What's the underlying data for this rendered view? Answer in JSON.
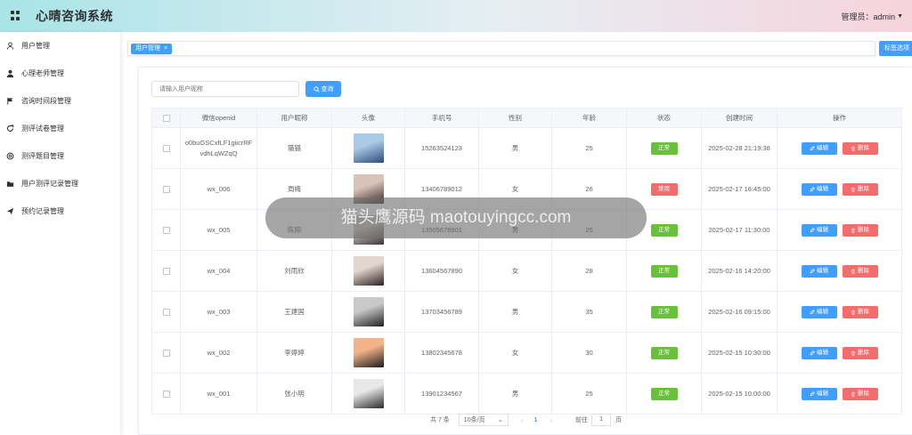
{
  "header": {
    "title": "心晴咨询系统",
    "user_label": "管理员：admin"
  },
  "sidebar": {
    "items": [
      {
        "label": "用户管理",
        "icon": "user-icon"
      },
      {
        "label": "心理老师管理",
        "icon": "user-filled-icon"
      },
      {
        "label": "咨询时间段管理",
        "icon": "flag-icon"
      },
      {
        "label": "测评试卷管理",
        "icon": "refresh-icon"
      },
      {
        "label": "测评题目管理",
        "icon": "circle-icon"
      },
      {
        "label": "用户测评记录管理",
        "icon": "folder-icon"
      },
      {
        "label": "预约记录管理",
        "icon": "send-icon"
      }
    ]
  },
  "tabs": {
    "active_tab": "用户管理",
    "options_label": "标签选项"
  },
  "search": {
    "placeholder": "请输入用户昵称",
    "button_label": "查询"
  },
  "table": {
    "columns": [
      "微信openid",
      "用户昵称",
      "头像",
      "手机号",
      "性别",
      "年龄",
      "状态",
      "创建时间",
      "操作"
    ],
    "edit_label": "编辑",
    "delete_label": "删除",
    "rows": [
      {
        "openid": "o0buGSCxfLF1giicrRFvdhLqWZqQ",
        "nickname": "猫猫",
        "phone": "15263524123",
        "gender": "男",
        "age": "25",
        "status": "正常",
        "created": "2025-02-28 21:19:38",
        "avatar": [
          "#a9cbe6",
          "#2c4b7a"
        ]
      },
      {
        "openid": "wx_006",
        "nickname": "周梅",
        "phone": "13406789012",
        "gender": "女",
        "age": "26",
        "status": "禁用",
        "created": "2025-02-17 16:45:00",
        "avatar": [
          "#d9c2b8",
          "#3a2a27"
        ]
      },
      {
        "openid": "wx_005",
        "nickname": "陈阳",
        "phone": "13505678901",
        "gender": "男",
        "age": "25",
        "status": "正常",
        "created": "2025-02-17 11:30:00",
        "avatar": [
          "#c7c4c1",
          "#3b3633"
        ]
      },
      {
        "openid": "wx_004",
        "nickname": "刘雨欣",
        "phone": "13604567890",
        "gender": "女",
        "age": "28",
        "status": "正常",
        "created": "2025-02-16 14:20:00",
        "avatar": [
          "#e3d6cf",
          "#2b211e"
        ]
      },
      {
        "openid": "wx_003",
        "nickname": "王建国",
        "phone": "13703456789",
        "gender": "男",
        "age": "35",
        "status": "正常",
        "created": "2025-02-16 09:15:00",
        "avatar": [
          "#c9c9c9",
          "#1f1f1f"
        ]
      },
      {
        "openid": "wx_002",
        "nickname": "李婷婷",
        "phone": "13802345678",
        "gender": "女",
        "age": "30",
        "status": "正常",
        "created": "2025-02-15 10:30:00",
        "avatar": [
          "#f2b38a",
          "#1b1b1b"
        ]
      },
      {
        "openid": "wx_001",
        "nickname": "张小明",
        "phone": "13901234567",
        "gender": "男",
        "age": "25",
        "status": "正常",
        "created": "2025-02-15 10:00:00",
        "avatar": [
          "#e8e8e8",
          "#2a2a2a"
        ]
      }
    ]
  },
  "pagination": {
    "total_label": "共 7 条",
    "page_size": "10条/页",
    "current_page": "1",
    "goto_label": "前往",
    "goto_value": "1",
    "page_unit": "页"
  },
  "watermark": {
    "text": "猫头鹰源码 maotouyingcc.com"
  },
  "colors": {
    "primary": "#409eff",
    "success": "#67c23a",
    "danger": "#f56c6c"
  }
}
